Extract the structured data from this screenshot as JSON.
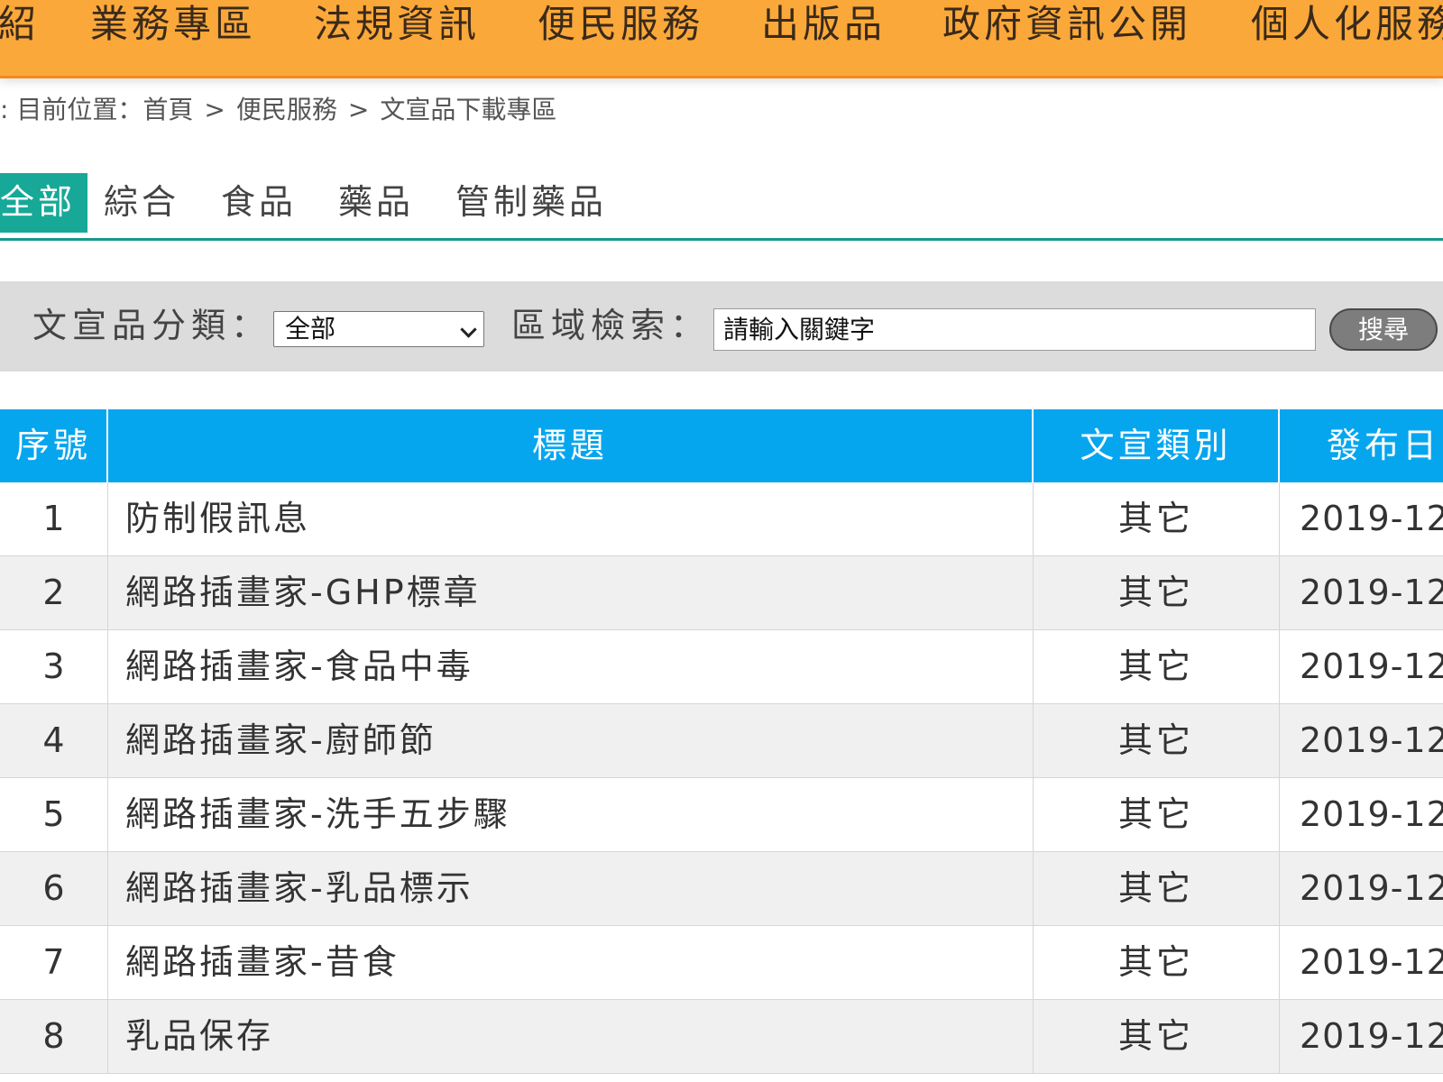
{
  "nav": {
    "items": [
      "紹",
      "業務專區",
      "法規資訊",
      "便民服務",
      "出版品",
      "政府資訊公開",
      "個人化服務"
    ]
  },
  "breadcrumb": {
    "prefix": ": 目前位置：",
    "items": [
      "首頁",
      "便民服務",
      "文宣品下載專區"
    ],
    "separator": ">"
  },
  "tabs": [
    "全部",
    "綜合",
    "食品",
    "藥品",
    "管制藥品"
  ],
  "active_tab": "全部",
  "search": {
    "category_label": "文宣品分類：",
    "category_value": "全部",
    "area_label": "區域檢索：",
    "placeholder": "請輸入關鍵字",
    "button_label": "搜尋"
  },
  "table": {
    "headers": [
      "序號",
      "標題",
      "文宣類別",
      "發布日"
    ],
    "rows": [
      {
        "num": "1",
        "title": "防制假訊息",
        "category": "其它",
        "date": "2019-12"
      },
      {
        "num": "2",
        "title": "網路插畫家-GHP標章",
        "category": "其它",
        "date": "2019-12"
      },
      {
        "num": "3",
        "title": "網路插畫家-食品中毒",
        "category": "其它",
        "date": "2019-12"
      },
      {
        "num": "4",
        "title": "網路插畫家-廚師節",
        "category": "其它",
        "date": "2019-12"
      },
      {
        "num": "5",
        "title": "網路插畫家-洗手五步驟",
        "category": "其它",
        "date": "2019-12"
      },
      {
        "num": "6",
        "title": "網路插畫家-乳品標示",
        "category": "其它",
        "date": "2019-12"
      },
      {
        "num": "7",
        "title": "網路插畫家-昔食",
        "category": "其它",
        "date": "2019-12"
      },
      {
        "num": "8",
        "title": "乳品保存",
        "category": "其它",
        "date": "2019-12"
      }
    ]
  },
  "colors": {
    "nav_bg": "#fba83a",
    "tab_active": "#17a898",
    "table_header": "#06a6ef",
    "search_bg": "#dcdcdc"
  }
}
